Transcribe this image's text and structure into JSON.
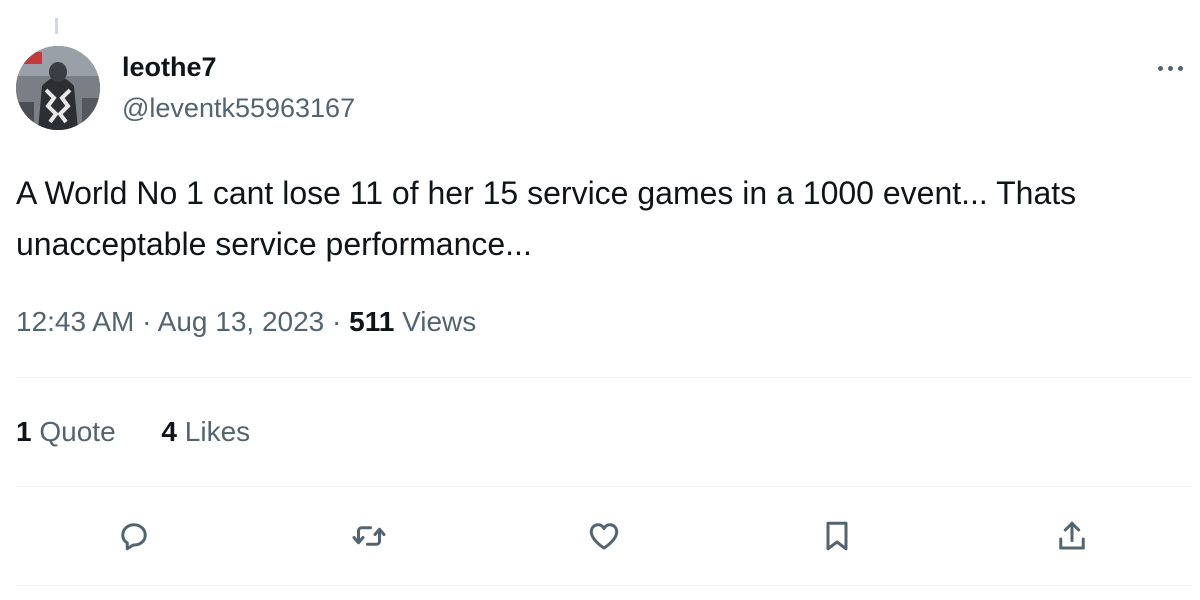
{
  "author": {
    "display_name": "leothe7",
    "handle": "@leventk55963167"
  },
  "tweet": {
    "text": "A World No 1 cant lose 11 of her 15 service games in a 1000 event... Thats unacceptable service performance...",
    "time": "12:43 AM",
    "separator": "·",
    "date": "Aug 13, 2023",
    "views_count": "511",
    "views_label": "Views"
  },
  "stats": {
    "quotes_count": "1",
    "quotes_label": "Quote",
    "likes_count": "4",
    "likes_label": "Likes"
  },
  "icons": {
    "more": "more-dots-icon",
    "reply": "reply-icon",
    "retweet": "retweet-icon",
    "like": "heart-icon",
    "bookmark": "bookmark-icon",
    "share": "share-icon"
  },
  "colors": {
    "primary_text": "#0f1419",
    "secondary_text": "#536471",
    "divider": "#eff3f4"
  }
}
